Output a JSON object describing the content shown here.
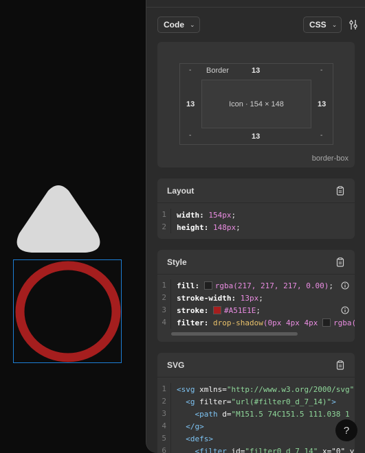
{
  "toolbar": {
    "format_label": "Code",
    "language_label": "CSS"
  },
  "box_model": {
    "border_label": "Border",
    "top": "13",
    "bottom": "13",
    "left": "13",
    "right": "13",
    "outer_top_left": "-",
    "outer_top_right": "-",
    "outer_bottom_left": "-",
    "outer_bottom_right": "-",
    "content_label": "Icon · 154 × 148",
    "box_sizing": "border-box"
  },
  "layout": {
    "title": "Layout",
    "lines": [
      {
        "num": "1",
        "prop": "width:",
        "value": "154px",
        "end": ";"
      },
      {
        "num": "2",
        "prop": "height:",
        "value": "148px",
        "end": ";"
      }
    ]
  },
  "style": {
    "title": "Style",
    "lines": [
      {
        "num": "1",
        "prop": "fill:",
        "value": "rgba(217, 217, 217, 0.00)",
        "end": ";",
        "swatch": "#1f1f1f"
      },
      {
        "num": "2",
        "prop": "stroke-width:",
        "value": "13px",
        "end": ";"
      },
      {
        "num": "3",
        "prop": "stroke:",
        "value": "#A51E1E",
        "end": ";",
        "swatch": "#A51E1E"
      },
      {
        "num": "4",
        "prop": "filter:",
        "fn": "drop-shadow",
        "value": "(0px 4px 4px",
        "extra": "rgba(",
        "swatch": "#1f1f1f"
      }
    ]
  },
  "svg": {
    "title": "SVG",
    "lines": [
      {
        "num": "1",
        "text_a": "<svg",
        "attr": " xmlns=",
        "str": "\"http://www.w3.org/2000/svg\""
      },
      {
        "num": "2",
        "text_a": "  <g",
        "attr": " filter=",
        "str": "\"url(#filter0_d_7_14)\"",
        "tail": ">"
      },
      {
        "num": "3",
        "text_a": "    <path",
        "attr": " d=",
        "str": "\"M151.5 74C151.5 111.038 1"
      },
      {
        "num": "4",
        "text_a": "  </g>"
      },
      {
        "num": "5",
        "text_a": "  <defs>"
      },
      {
        "num": "6",
        "text_a": "    <filter",
        "attr": " id=",
        "str": "\"filter0_d_7_14\"",
        "tail": " x=\"0\" y"
      }
    ]
  },
  "help": {
    "label": "?"
  },
  "colors": {
    "selection": "#1d7fd6",
    "circle_stroke": "#A51E1E",
    "triangle_fill": "#D9D9D9"
  }
}
